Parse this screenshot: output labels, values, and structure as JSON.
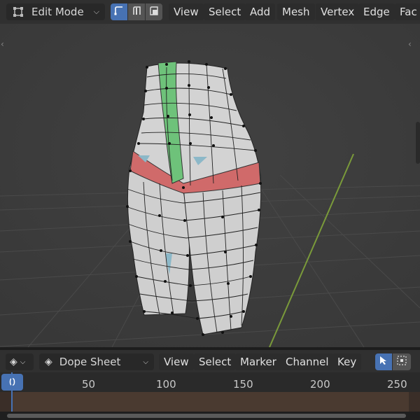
{
  "header": {
    "mode_label": "Edit Mode",
    "menus": [
      "View",
      "Select",
      "Add",
      "Mesh",
      "Vertex",
      "Edge",
      "Fac"
    ]
  },
  "timeline": {
    "editor_label": "Dope Sheet",
    "menus": [
      "View",
      "Select",
      "Marker",
      "Channel",
      "Key"
    ],
    "current_frame": "0",
    "ticks": [
      "50",
      "100",
      "150",
      "200",
      "250"
    ]
  },
  "colors": {
    "accent": "#4772b3",
    "selected_face": "#d06a6a",
    "seam_face": "#6ec27a",
    "mesh": "#cfcfcf"
  }
}
